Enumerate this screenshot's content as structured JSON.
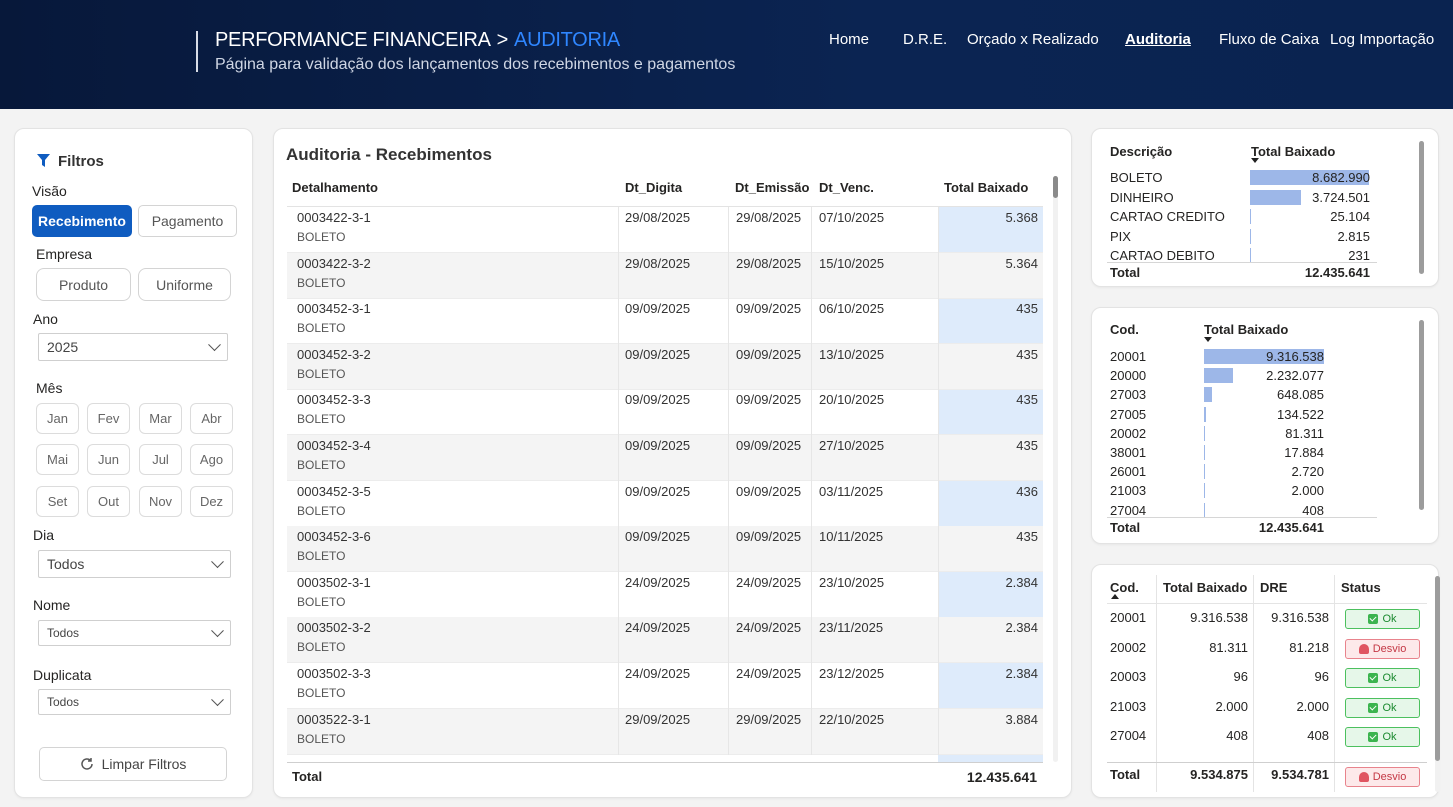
{
  "header": {
    "title_main": "PERFORMANCE FINANCEIRA",
    "title_sep": ">",
    "title_current": "AUDITORIA",
    "subtitle": "Página para validação dos lançamentos dos recebimentos e pagamentos",
    "nav": [
      "Home",
      "D.R.E.",
      "Orçado x Realizado",
      "Auditoria",
      "Fluxo de Caixa",
      "Log Importação"
    ]
  },
  "filters": {
    "title": "Filtros",
    "visao_label": "Visão",
    "visao": [
      "Recebimento",
      "Pagamento"
    ],
    "empresa_label": "Empresa",
    "empresa": [
      "Produto",
      "Uniforme"
    ],
    "ano_label": "Ano",
    "ano_value": "2025",
    "mes_label": "Mês",
    "meses": [
      "Jan",
      "Fev",
      "Mar",
      "Abr",
      "Mai",
      "Jun",
      "Jul",
      "Ago",
      "Set",
      "Out",
      "Nov",
      "Dez"
    ],
    "dia_label": "Dia",
    "dia_value": "Todos",
    "nome_label": "Nome",
    "nome_value": "Todos",
    "duplicata_label": "Duplicata",
    "duplicata_value": "Todos",
    "clear_label": "Limpar Filtros"
  },
  "main_table": {
    "title": "Auditoria - Recebimentos",
    "columns": [
      "Detalhamento",
      "Dt_Digita",
      "Dt_Emissão",
      "Dt_Venc.",
      "Total Baixado"
    ],
    "rows": [
      {
        "id": "0003422-3-1",
        "tipo": "BOLETO",
        "dig": "29/08/2025",
        "emi": "29/08/2025",
        "venc": "07/10/2025",
        "total": "5.368"
      },
      {
        "id": "0003422-3-2",
        "tipo": "BOLETO",
        "dig": "29/08/2025",
        "emi": "29/08/2025",
        "venc": "15/10/2025",
        "total": "5.364"
      },
      {
        "id": "0003452-3-1",
        "tipo": "BOLETO",
        "dig": "09/09/2025",
        "emi": "09/09/2025",
        "venc": "06/10/2025",
        "total": "435"
      },
      {
        "id": "0003452-3-2",
        "tipo": "BOLETO",
        "dig": "09/09/2025",
        "emi": "09/09/2025",
        "venc": "13/10/2025",
        "total": "435"
      },
      {
        "id": "0003452-3-3",
        "tipo": "BOLETO",
        "dig": "09/09/2025",
        "emi": "09/09/2025",
        "venc": "20/10/2025",
        "total": "435"
      },
      {
        "id": "0003452-3-4",
        "tipo": "BOLETO",
        "dig": "09/09/2025",
        "emi": "09/09/2025",
        "venc": "27/10/2025",
        "total": "435"
      },
      {
        "id": "0003452-3-5",
        "tipo": "BOLETO",
        "dig": "09/09/2025",
        "emi": "09/09/2025",
        "venc": "03/11/2025",
        "total": "436"
      },
      {
        "id": "0003452-3-6",
        "tipo": "BOLETO",
        "dig": "09/09/2025",
        "emi": "09/09/2025",
        "venc": "10/11/2025",
        "total": "435"
      },
      {
        "id": "0003502-3-1",
        "tipo": "BOLETO",
        "dig": "24/09/2025",
        "emi": "24/09/2025",
        "venc": "23/10/2025",
        "total": "2.384"
      },
      {
        "id": "0003502-3-2",
        "tipo": "BOLETO",
        "dig": "24/09/2025",
        "emi": "24/09/2025",
        "venc": "23/11/2025",
        "total": "2.384"
      },
      {
        "id": "0003502-3-3",
        "tipo": "BOLETO",
        "dig": "24/09/2025",
        "emi": "24/09/2025",
        "venc": "23/12/2025",
        "total": "2.384"
      },
      {
        "id": "0003522-3-1",
        "tipo": "BOLETO",
        "dig": "29/09/2025",
        "emi": "29/09/2025",
        "venc": "22/10/2025",
        "total": "3.884"
      }
    ],
    "total_label": "Total",
    "total_value": "12.435.641"
  },
  "desc_table": {
    "col1": "Descrição",
    "col2": "Total Baixado",
    "rows": [
      {
        "label": "BOLETO",
        "value": "8.682.990",
        "v": 8682990
      },
      {
        "label": "DINHEIRO",
        "value": "3.724.501",
        "v": 3724501
      },
      {
        "label": "CARTAO CREDITO",
        "value": "25.104",
        "v": 25104
      },
      {
        "label": "PIX",
        "value": "2.815",
        "v": 2815
      },
      {
        "label": "CARTAO DEBITO",
        "value": "231",
        "v": 231
      }
    ],
    "total_label": "Total",
    "total_value": "12.435.641"
  },
  "cod_table": {
    "col1": "Cod.",
    "col2": "Total Baixado",
    "rows": [
      {
        "label": "20001",
        "value": "9.316.538",
        "v": 9316538
      },
      {
        "label": "20000",
        "value": "2.232.077",
        "v": 2232077
      },
      {
        "label": "27003",
        "value": "648.085",
        "v": 648085
      },
      {
        "label": "27005",
        "value": "134.522",
        "v": 134522
      },
      {
        "label": "20002",
        "value": "81.311",
        "v": 81311
      },
      {
        "label": "38001",
        "value": "17.884",
        "v": 17884
      },
      {
        "label": "26001",
        "value": "2.720",
        "v": 2720
      },
      {
        "label": "21003",
        "value": "2.000",
        "v": 2000
      },
      {
        "label": "27004",
        "value": "408",
        "v": 408
      }
    ],
    "total_label": "Total",
    "total_value": "12.435.641"
  },
  "status_table": {
    "columns": [
      "Cod.",
      "Total Baixado",
      "DRE",
      "Status"
    ],
    "rows": [
      {
        "cod": "20001",
        "total": "9.316.538",
        "dre": "9.316.538",
        "status": "Ok"
      },
      {
        "cod": "20002",
        "total": "81.311",
        "dre": "81.218",
        "status": "Desvio"
      },
      {
        "cod": "20003",
        "total": "96",
        "dre": "96",
        "status": "Ok"
      },
      {
        "cod": "21003",
        "total": "2.000",
        "dre": "2.000",
        "status": "Ok"
      },
      {
        "cod": "27004",
        "total": "408",
        "dre": "408",
        "status": "Ok"
      }
    ],
    "total_label": "Total",
    "total_value": "9.534.875",
    "total_dre": "9.534.781",
    "total_status": "Desvio"
  },
  "colors": {
    "header_bg": "#0b2452",
    "accent": "#2f86ff",
    "primary_button": "#0f5cc0",
    "data_bar": "#9db7e8",
    "highlight_column": "#deebfb",
    "ok": "#3cb44f",
    "desvio": "#e05561"
  }
}
